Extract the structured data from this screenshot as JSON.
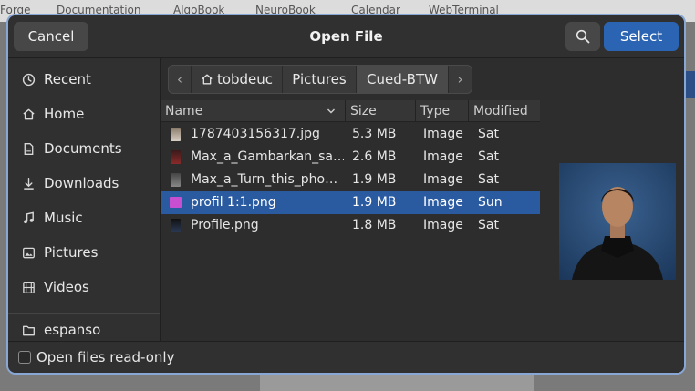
{
  "background": {
    "bookmarks": [
      "Forge",
      "Documentation",
      "AlgoBook",
      "NeuroBook",
      "Calendar",
      "WebTerminal"
    ]
  },
  "dialog": {
    "title": "Open File",
    "cancel_label": "Cancel",
    "select_label": "Select",
    "accent_color": "#2a64b3"
  },
  "sidebar": {
    "items": [
      {
        "label": "Recent",
        "icon": "clock-icon"
      },
      {
        "label": "Home",
        "icon": "home-icon"
      },
      {
        "label": "Documents",
        "icon": "document-icon"
      },
      {
        "label": "Downloads",
        "icon": "download-icon"
      },
      {
        "label": "Music",
        "icon": "music-icon"
      },
      {
        "label": "Pictures",
        "icon": "picture-icon"
      },
      {
        "label": "Videos",
        "icon": "film-icon"
      },
      {
        "label": "espanso",
        "icon": "folder-icon"
      }
    ]
  },
  "pathbar": {
    "home": "tobdeuc",
    "pictures": "Pictures",
    "current": "Cued-BTW"
  },
  "columns": {
    "name": "Name",
    "size": "Size",
    "type": "Type",
    "modified": "Modified"
  },
  "files": [
    {
      "name": "1787403156317.jpg",
      "size": "5.3 MB",
      "type": "Image",
      "modified": "Sat"
    },
    {
      "name": "Max_a_Gambarkan_sa…",
      "size": "2.6 MB",
      "type": "Image",
      "modified": "Sat"
    },
    {
      "name": "Max_a_Turn_this_pho…",
      "size": "1.9 MB",
      "type": "Image",
      "modified": "Sat"
    },
    {
      "name": "profil 1:1.png",
      "size": "1.9 MB",
      "type": "Image",
      "modified": "Sun"
    },
    {
      "name": "Profile.png",
      "size": "1.8 MB",
      "type": "Image",
      "modified": "Sat"
    }
  ],
  "footer": {
    "readonly_label": "Open files read-only"
  }
}
